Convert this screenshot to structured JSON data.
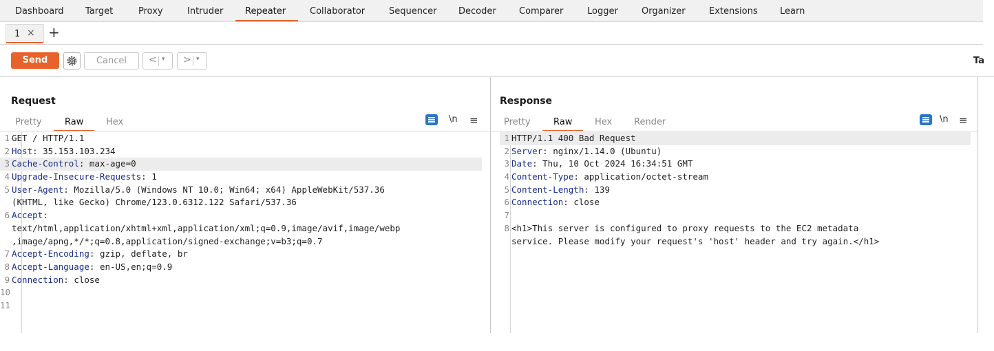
{
  "top_tabs": [
    "Dashboard",
    "Target",
    "Proxy",
    "Intruder",
    "Repeater",
    "Collaborator",
    "Sequencer",
    "Decoder",
    "Comparer",
    "Logger",
    "Organizer",
    "Extensions",
    "Learn"
  ],
  "active_top_tab": "Repeater",
  "sub_tab": {
    "label": "1",
    "close": "×",
    "add": "+"
  },
  "toolbar": {
    "send": "Send",
    "cancel": "Cancel",
    "back": "<",
    "forward": ">",
    "dropdown": "▾",
    "target_label": "Ta"
  },
  "request": {
    "title": "Request",
    "tabs": [
      "Pretty",
      "Raw",
      "Hex"
    ],
    "active_tab": "Raw",
    "icons": {
      "wrap": "wrap-icon",
      "newline": "\\n",
      "menu": "≡"
    },
    "lines": [
      {
        "n": "1",
        "h": "",
        "v": "GET / HTTP/1.1"
      },
      {
        "n": "2",
        "h": "Host",
        "v": ": 35.153.103.234"
      },
      {
        "n": "3",
        "h": "Cache-Control",
        "v": ": max-age=0"
      },
      {
        "n": "4",
        "h": "Upgrade-Insecure-Requests",
        "v": ": 1"
      },
      {
        "n": "5",
        "h": "User-Agent",
        "v": ": Mozilla/5.0 (Windows NT 10.0; Win64; x64) AppleWebKit/537.36"
      },
      {
        "n": "",
        "h": "",
        "v": "(KHTML, like Gecko) Chrome/123.0.6312.122 Safari/537.36"
      },
      {
        "n": "6",
        "h": "Accept",
        "v": ":"
      },
      {
        "n": "",
        "h": "",
        "v": "text/html,application/xhtml+xml,application/xml;q=0.9,image/avif,image/webp"
      },
      {
        "n": "",
        "h": "",
        "v": ",image/apng,*/*;q=0.8,application/signed-exchange;v=b3;q=0.7"
      },
      {
        "n": "7",
        "h": "Accept-Encoding",
        "v": ": gzip, deflate, br"
      },
      {
        "n": "8",
        "h": "Accept-Language",
        "v": ": en-US,en;q=0.9"
      },
      {
        "n": "9",
        "h": "Connection",
        "v": ": close"
      },
      {
        "n": "10",
        "h": "",
        "v": ""
      },
      {
        "n": "11",
        "h": "",
        "v": ""
      }
    ]
  },
  "response": {
    "title": "Response",
    "tabs": [
      "Pretty",
      "Raw",
      "Hex",
      "Render"
    ],
    "active_tab": "Raw",
    "icons": {
      "wrap": "wrap-icon",
      "newline": "\\n",
      "menu": "≡"
    },
    "lines": [
      {
        "n": "1",
        "h": "",
        "v": "HTTP/1.1 400 Bad Request"
      },
      {
        "n": "2",
        "h": "Server",
        "v": ": nginx/1.14.0 (Ubuntu)"
      },
      {
        "n": "3",
        "h": "Date",
        "v": ": Thu, 10 Oct 2024 16:34:51 GMT"
      },
      {
        "n": "4",
        "h": "Content-Type",
        "v": ": application/octet-stream"
      },
      {
        "n": "5",
        "h": "Content-Length",
        "v": ": 139"
      },
      {
        "n": "6",
        "h": "Connection",
        "v": ": close"
      },
      {
        "n": "7",
        "h": "",
        "v": ""
      },
      {
        "n": "8",
        "h": "",
        "v": "<h1>This server is configured to proxy requests to the EC2 metadata"
      },
      {
        "n": "",
        "h": "",
        "v": "service. Please modify your request's 'host' header and try again.</h1>"
      }
    ]
  },
  "colors": {
    "accent": "#e8632b",
    "blue": "#2d74c4",
    "header_name": "#1a2e8a"
  }
}
